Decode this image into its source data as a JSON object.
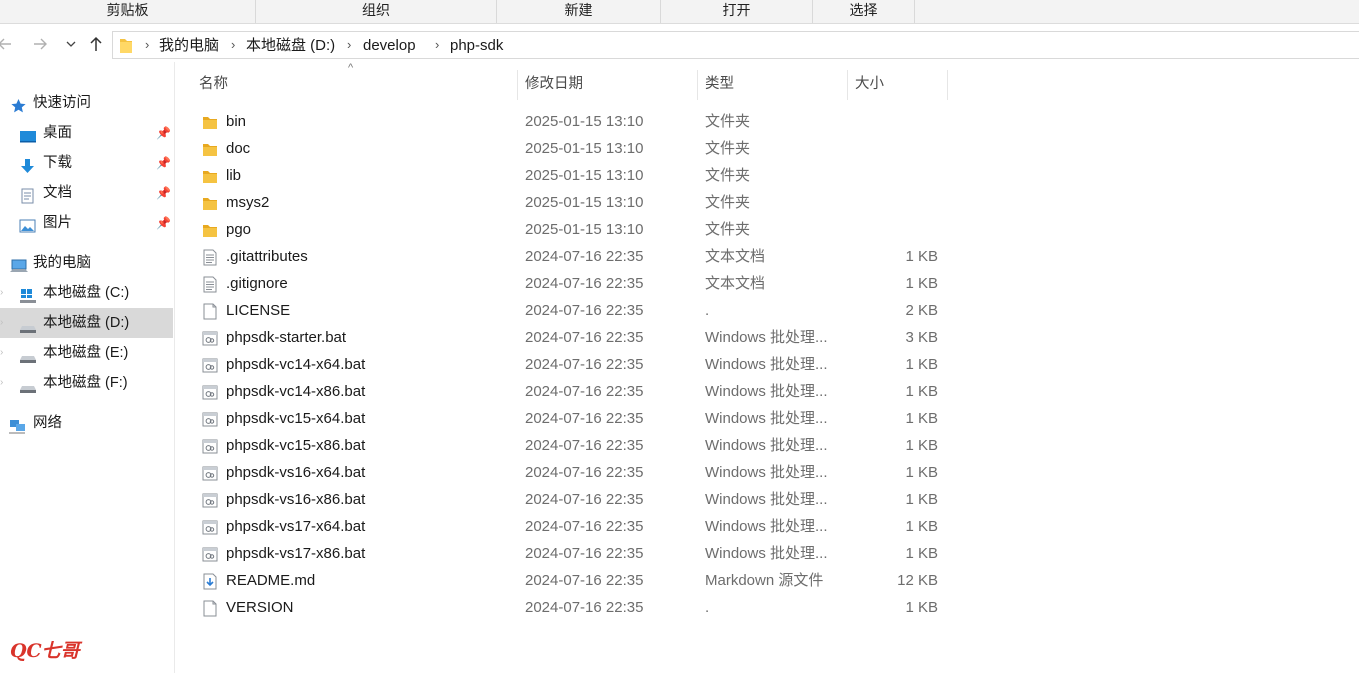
{
  "ribbon": {
    "groups": [
      "剪贴板",
      "组织",
      "新建",
      "打开",
      "选择"
    ]
  },
  "address": {
    "crumbs": [
      "我的电脑",
      "本地磁盘 (D:)",
      "develop",
      "php-sdk"
    ]
  },
  "nav": {
    "quick_access": "快速访问",
    "quick_items": [
      "桌面",
      "下载",
      "文档",
      "图片"
    ],
    "this_pc": "我的电脑",
    "drives": [
      "本地磁盘 (C:)",
      "本地磁盘 (D:)",
      "本地磁盘 (E:)",
      "本地磁盘 (F:)"
    ],
    "network": "网络"
  },
  "columns": {
    "name": "名称",
    "date": "修改日期",
    "type": "类型",
    "size": "大小"
  },
  "files": [
    {
      "name": "bin",
      "date": "2025-01-15 13:10",
      "type": "文件夹",
      "size": "",
      "icon": "folder-icon"
    },
    {
      "name": "doc",
      "date": "2025-01-15 13:10",
      "type": "文件夹",
      "size": "",
      "icon": "folder-icon"
    },
    {
      "name": "lib",
      "date": "2025-01-15 13:10",
      "type": "文件夹",
      "size": "",
      "icon": "folder-icon"
    },
    {
      "name": "msys2",
      "date": "2025-01-15 13:10",
      "type": "文件夹",
      "size": "",
      "icon": "folder-icon"
    },
    {
      "name": "pgo",
      "date": "2025-01-15 13:10",
      "type": "文件夹",
      "size": "",
      "icon": "folder-icon"
    },
    {
      "name": ".gitattributes",
      "date": "2024-07-16 22:35",
      "type": "文本文档",
      "size": "1 KB",
      "icon": "text-file-icon"
    },
    {
      "name": ".gitignore",
      "date": "2024-07-16 22:35",
      "type": "文本文档",
      "size": "1 KB",
      "icon": "text-file-icon"
    },
    {
      "name": "LICENSE",
      "date": "2024-07-16 22:35",
      "type": ".",
      "size": "2 KB",
      "icon": "blank-file-icon"
    },
    {
      "name": "phpsdk-starter.bat",
      "date": "2024-07-16 22:35",
      "type": "Windows 批处理...",
      "size": "3 KB",
      "icon": "batch-file-icon"
    },
    {
      "name": "phpsdk-vc14-x64.bat",
      "date": "2024-07-16 22:35",
      "type": "Windows 批处理...",
      "size": "1 KB",
      "icon": "batch-file-icon"
    },
    {
      "name": "phpsdk-vc14-x86.bat",
      "date": "2024-07-16 22:35",
      "type": "Windows 批处理...",
      "size": "1 KB",
      "icon": "batch-file-icon"
    },
    {
      "name": "phpsdk-vc15-x64.bat",
      "date": "2024-07-16 22:35",
      "type": "Windows 批处理...",
      "size": "1 KB",
      "icon": "batch-file-icon"
    },
    {
      "name": "phpsdk-vc15-x86.bat",
      "date": "2024-07-16 22:35",
      "type": "Windows 批处理...",
      "size": "1 KB",
      "icon": "batch-file-icon"
    },
    {
      "name": "phpsdk-vs16-x64.bat",
      "date": "2024-07-16 22:35",
      "type": "Windows 批处理...",
      "size": "1 KB",
      "icon": "batch-file-icon"
    },
    {
      "name": "phpsdk-vs16-x86.bat",
      "date": "2024-07-16 22:35",
      "type": "Windows 批处理...",
      "size": "1 KB",
      "icon": "batch-file-icon"
    },
    {
      "name": "phpsdk-vs17-x64.bat",
      "date": "2024-07-16 22:35",
      "type": "Windows 批处理...",
      "size": "1 KB",
      "icon": "batch-file-icon"
    },
    {
      "name": "phpsdk-vs17-x86.bat",
      "date": "2024-07-16 22:35",
      "type": "Windows 批处理...",
      "size": "1 KB",
      "icon": "batch-file-icon"
    },
    {
      "name": "README.md",
      "date": "2024-07-16 22:35",
      "type": "Markdown 源文件",
      "size": "12 KB",
      "icon": "markdown-file-icon"
    },
    {
      "name": "VERSION",
      "date": "2024-07-16 22:35",
      "type": ".",
      "size": "1 KB",
      "icon": "blank-file-icon"
    }
  ],
  "watermark": "QC七哥",
  "colors": {
    "folder": "#f5c342",
    "selected": "#d9d9d9",
    "watermark": "#d9342b"
  }
}
